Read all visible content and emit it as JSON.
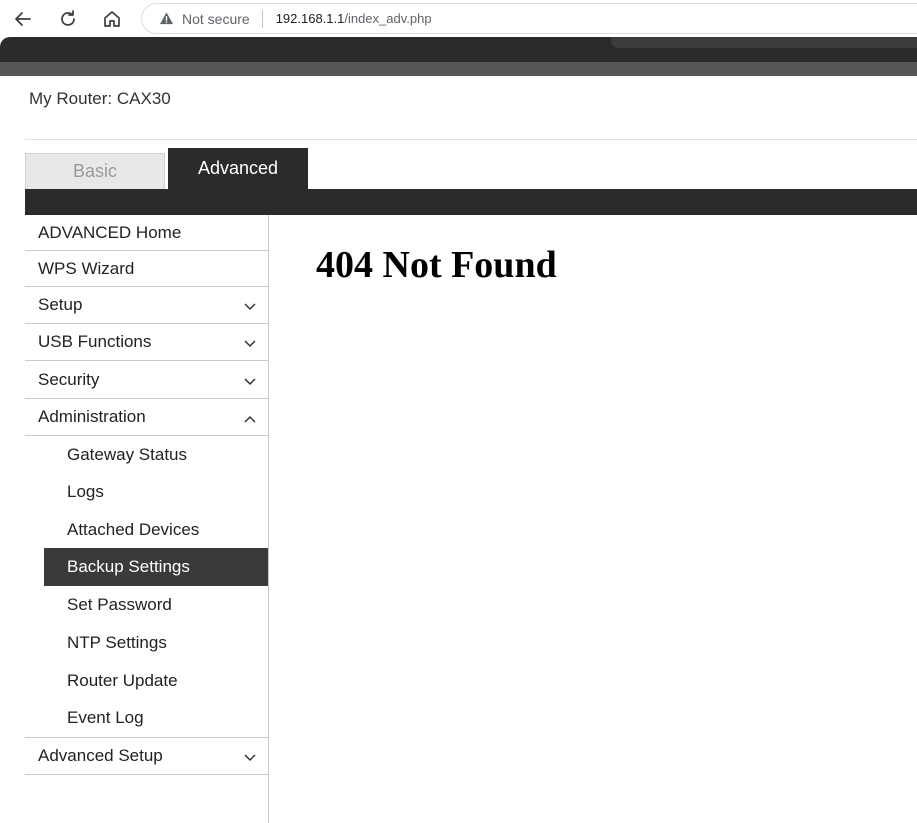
{
  "browser": {
    "security_label": "Not secure",
    "url_host": "192.168.1.1",
    "url_path": "/index_adv.php"
  },
  "header": {
    "router_label": "My Router:",
    "router_model": "CAX30"
  },
  "tabs": [
    {
      "label": "Basic",
      "active": false
    },
    {
      "label": "Advanced",
      "active": true
    }
  ],
  "sidebar": {
    "items": [
      {
        "label": "ADVANCED Home",
        "expandable": false
      },
      {
        "label": "WPS Wizard",
        "expandable": false
      },
      {
        "label": "Setup",
        "expandable": true,
        "expanded": false
      },
      {
        "label": "USB Functions",
        "expandable": true,
        "expanded": false
      },
      {
        "label": "Security",
        "expandable": true,
        "expanded": false
      },
      {
        "label": "Administration",
        "expandable": true,
        "expanded": true
      },
      {
        "label": "Advanced Setup",
        "expandable": true,
        "expanded": false
      }
    ],
    "administration_subitems": [
      {
        "label": "Gateway Status",
        "active": false
      },
      {
        "label": "Logs",
        "active": false
      },
      {
        "label": "Attached Devices",
        "active": false
      },
      {
        "label": "Backup Settings",
        "active": true
      },
      {
        "label": "Set Password",
        "active": false
      },
      {
        "label": "NTP Settings",
        "active": false
      },
      {
        "label": "Router Update",
        "active": false
      },
      {
        "label": "Event Log",
        "active": false
      }
    ]
  },
  "content": {
    "title": "404 Not Found"
  },
  "colors": {
    "header_dark": "#2b2b2b",
    "header_gray": "#555555",
    "active_item_bg": "#3a3a3a",
    "divider": "#c9c9c9"
  },
  "icons": [
    "back-arrow-icon",
    "reload-icon",
    "home-icon",
    "warning-triangle-icon",
    "chevron-down-icon",
    "chevron-up-icon"
  ]
}
